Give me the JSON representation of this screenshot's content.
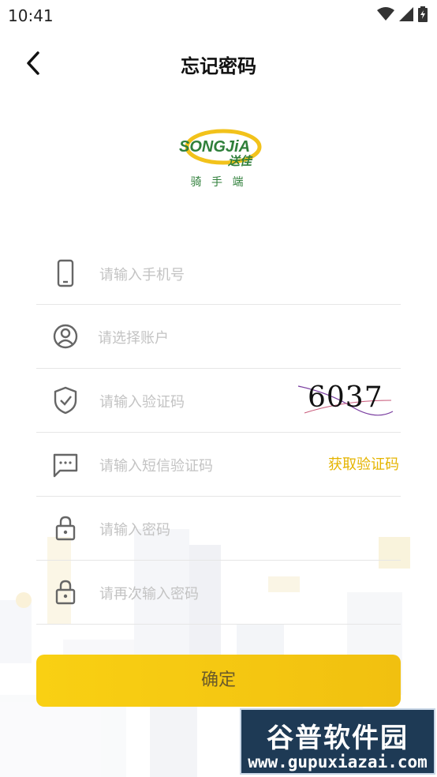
{
  "status_bar": {
    "time": "10:41",
    "icons": [
      "wifi-icon",
      "signal-icon",
      "battery-icon"
    ]
  },
  "header": {
    "back_icon": "chevron-left-icon",
    "title": "忘记密码"
  },
  "logo": {
    "brand_text": "SONGJiA",
    "brand_cn": "送佳",
    "caption": "骑 手 端",
    "colors": {
      "green": "#2f7f3a",
      "yellow": "#f2c21b"
    }
  },
  "form": {
    "phone": {
      "icon": "phone-icon",
      "placeholder": "请输入手机号",
      "value": ""
    },
    "account": {
      "icon": "user-circle-icon",
      "placeholder": "请选择账户",
      "value": ""
    },
    "captcha": {
      "icon": "shield-check-icon",
      "placeholder": "请输入验证码",
      "value": "",
      "image_text": "6037"
    },
    "sms": {
      "icon": "message-icon",
      "placeholder": "请输入短信验证码",
      "value": "",
      "button_label": "获取验证码"
    },
    "password": {
      "icon": "lock-icon",
      "placeholder": "请输入密码",
      "value": ""
    },
    "password_confirm": {
      "icon": "lock-icon",
      "placeholder": "请再次输入密码",
      "value": ""
    }
  },
  "confirm_button": {
    "label": "确定",
    "color": "#f6c914"
  },
  "accent_color": "#e5b400",
  "watermark": {
    "title": "谷普软件园",
    "url": "www.gupuxiazai.com"
  }
}
